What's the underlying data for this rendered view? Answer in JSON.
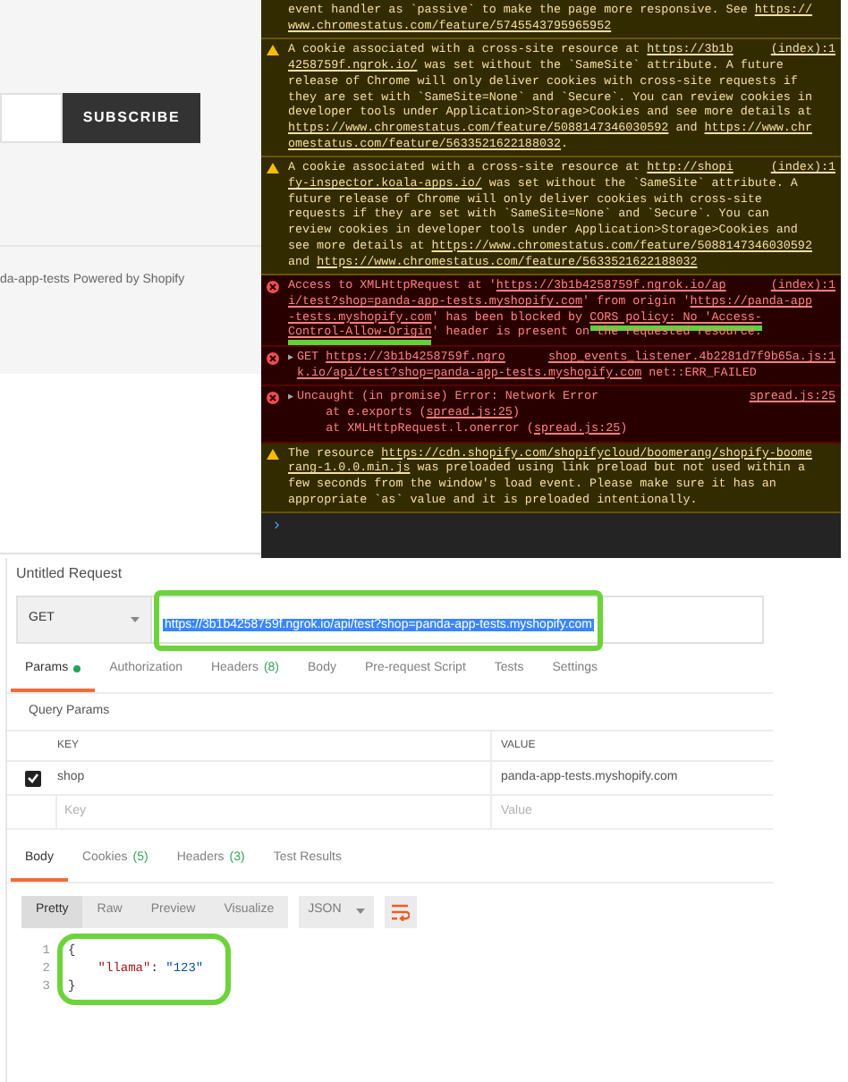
{
  "store_page": {
    "subscribe_button": "SUBSCRIBE",
    "footer_text": "da-app-tests Powered by Shopify"
  },
  "console": {
    "messages": [
      {
        "kind": "warning",
        "lines": [
          [
            {
              "kind": "text",
              "text": "event handler as `passive` to make the page more responsive. See "
            },
            {
              "kind": "link",
              "text": "https://"
            }
          ],
          [
            {
              "kind": "link",
              "text": "www.chromestatus.com/feature/5745543795965952"
            }
          ]
        ]
      },
      {
        "kind": "warning",
        "source": "(index):1",
        "lines": [
          [
            {
              "kind": "text",
              "text": "A cookie associated with a cross-site resource at "
            },
            {
              "kind": "link",
              "text": "https://3b1b"
            }
          ],
          [
            {
              "kind": "link",
              "text": "4258759f.ngrok.io/"
            },
            {
              "kind": "text",
              "text": " was set without the `SameSite` attribute. A future"
            }
          ],
          [
            {
              "kind": "text",
              "text": "release of Chrome will only deliver cookies with cross-site requests if"
            }
          ],
          [
            {
              "kind": "text",
              "text": "they are set with `SameSite=None` and `Secure`. You can review cookies in"
            }
          ],
          [
            {
              "kind": "text",
              "text": "developer tools under Application>Storage>Cookies and see more details at"
            }
          ],
          [
            {
              "kind": "link",
              "text": "https://www.chromestatus.com/feature/5088147346030592"
            },
            {
              "kind": "text",
              "text": " and "
            },
            {
              "kind": "link",
              "text": "https://www.chr"
            }
          ],
          [
            {
              "kind": "link",
              "text": "omestatus.com/feature/5633521622188032"
            },
            {
              "kind": "text",
              "text": "."
            }
          ]
        ]
      },
      {
        "kind": "warning",
        "source": "(index):1",
        "lines": [
          [
            {
              "kind": "text",
              "text": "A cookie associated with a cross-site resource at "
            },
            {
              "kind": "link",
              "text": "http://shopi"
            }
          ],
          [
            {
              "kind": "link",
              "text": "fy-inspector.koala-apps.io/"
            },
            {
              "kind": "text",
              "text": " was set without the `SameSite` attribute. A"
            }
          ],
          [
            {
              "kind": "text",
              "text": "future release of Chrome will only deliver cookies with cross-site"
            }
          ],
          [
            {
              "kind": "text",
              "text": "requests if they are set with `SameSite=None` and `Secure`. You can"
            }
          ],
          [
            {
              "kind": "text",
              "text": "review cookies in developer tools under Application>Storage>Cookies and"
            }
          ],
          [
            {
              "kind": "text",
              "text": "see more details at "
            },
            {
              "kind": "link",
              "text": "https://www.chromestatus.com/feature/5088147346030592"
            }
          ],
          [
            {
              "kind": "text",
              "text": "and "
            },
            {
              "kind": "link",
              "text": "https://www.chromestatus.com/feature/5633521622188032"
            }
          ]
        ]
      },
      {
        "kind": "error",
        "source": "(index):1",
        "lines": [
          [
            {
              "kind": "text",
              "text": "Access to XMLHttpRequest at '"
            },
            {
              "kind": "link",
              "text": "https://3b1b4258759f.ngrok.io/ap"
            }
          ],
          [
            {
              "kind": "link",
              "text": "i/test?shop=panda-app-tests.myshopify.com"
            },
            {
              "kind": "text",
              "text": "' from origin '"
            },
            {
              "kind": "link",
              "text": "https://panda-app"
            }
          ],
          [
            {
              "kind": "link",
              "text": "-tests.myshopify.com"
            },
            {
              "kind": "text",
              "text": "' has been blocked by "
            },
            {
              "kind": "marked",
              "text": "CORS policy: No 'Access-"
            }
          ],
          [
            {
              "kind": "marked",
              "text": "Control-Allow-Origin"
            },
            {
              "kind": "text",
              "text": "' header is present on the requested resource."
            }
          ]
        ]
      },
      {
        "kind": "error",
        "toggle": "▶",
        "source": "shop_events_listener.4b2281d7f9b65a.js:1",
        "lines": [
          [
            {
              "kind": "text",
              "text": "GET "
            },
            {
              "kind": "link",
              "text": "https://3b1b4258759f.ngro"
            }
          ],
          [
            {
              "kind": "link",
              "text": "k.io/api/test?shop=panda-app-tests.myshopify.com"
            },
            {
              "kind": "text",
              "text": " net::ERR_FAILED"
            }
          ]
        ]
      },
      {
        "kind": "error",
        "toggle": "▶",
        "source": "spread.js:25",
        "lines": [
          [
            {
              "kind": "text",
              "text": "Uncaught (in promise) Error: Network Error"
            }
          ],
          [
            {
              "kind": "text",
              "text": "    at e.exports ("
            },
            {
              "kind": "link",
              "text": "spread.js:25"
            },
            {
              "kind": "text",
              "text": ")"
            }
          ],
          [
            {
              "kind": "text",
              "text": "    at XMLHttpRequest.l.onerror ("
            },
            {
              "kind": "link",
              "text": "spread.js:25"
            },
            {
              "kind": "text",
              "text": ")"
            }
          ]
        ]
      },
      {
        "kind": "warning",
        "lines": [
          [
            {
              "kind": "text",
              "text": "The resource "
            },
            {
              "kind": "link",
              "text": "https://cdn.shopify.com/shopifycloud/boomerang/shopify-boome"
            }
          ],
          [
            {
              "kind": "link",
              "text": "rang-1.0.0.min.js"
            },
            {
              "kind": "text",
              "text": " was preloaded using link preload but not used within a"
            }
          ],
          [
            {
              "kind": "text",
              "text": "few seconds from the window's load event. Please make sure it has an"
            }
          ],
          [
            {
              "kind": "text",
              "text": "appropriate `as` value and it is preloaded intentionally."
            }
          ]
        ]
      }
    ],
    "prompt": "›"
  },
  "request": {
    "title": "Untitled Request",
    "method": "GET",
    "url": "https://3b1b4258759f.ngrok.io/api/test?shop=panda-app-tests.myshopify.com",
    "tabs": [
      {
        "label": "Params",
        "dot": true,
        "selected": true
      },
      {
        "label": "Authorization",
        "dot": false,
        "selected": false
      },
      {
        "label": "Headers",
        "count": "(8)",
        "dot": false,
        "selected": false
      },
      {
        "label": "Body",
        "dot": false,
        "selected": false
      },
      {
        "label": "Pre-request Script",
        "dot": false,
        "selected": false
      },
      {
        "label": "Tests",
        "dot": false,
        "selected": false
      },
      {
        "label": "Settings",
        "dot": false,
        "selected": false
      }
    ],
    "query_params": {
      "title": "Query Params",
      "columns": [
        "KEY",
        "VALUE"
      ],
      "rows": [
        {
          "checked": true,
          "key": "shop",
          "value": "panda-app-tests.myshopify.com"
        }
      ],
      "new_row": {
        "key_placeholder": "Key",
        "value_placeholder": "Value"
      }
    }
  },
  "response": {
    "tabs": [
      {
        "label": "Body",
        "selected": true
      },
      {
        "label": "Cookies",
        "count": "(5)",
        "selected": false
      },
      {
        "label": "Headers",
        "count": "(3)",
        "selected": false
      },
      {
        "label": "Test Results",
        "selected": false
      }
    ],
    "views": [
      {
        "label": "Pretty",
        "selected": true
      },
      {
        "label": "Raw",
        "selected": false
      },
      {
        "label": "Preview",
        "selected": false
      },
      {
        "label": "Visualize",
        "selected": false
      }
    ],
    "format": "JSON",
    "code": [
      {
        "number": "1",
        "tokens": [
          {
            "kind": "punct",
            "text": "{"
          }
        ]
      },
      {
        "number": "2",
        "tokens": [
          {
            "kind": "key",
            "text": "    \"llama\""
          },
          {
            "kind": "punct",
            "text": ": "
          },
          {
            "kind": "string",
            "text": "\"123\""
          }
        ]
      },
      {
        "number": "3",
        "tokens": [
          {
            "kind": "punct",
            "text": "}"
          }
        ]
      }
    ]
  }
}
